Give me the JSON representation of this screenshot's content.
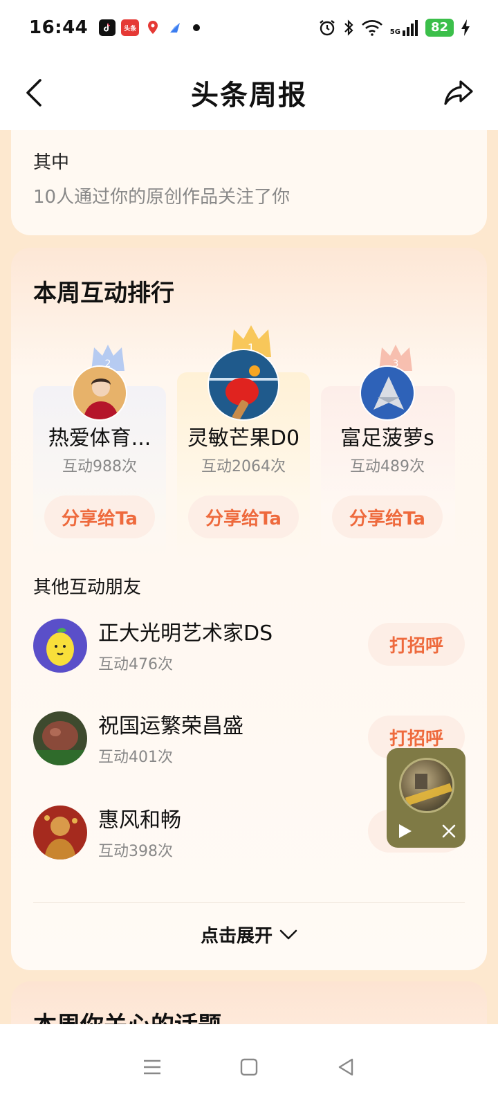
{
  "status_bar": {
    "time": "16:44",
    "battery": "82",
    "network": "5G",
    "toutiao_badge": "头条"
  },
  "header": {
    "title": "头条周报"
  },
  "followers_card": {
    "label": "其中",
    "description": "10人通过你的原创作品关注了你"
  },
  "ranking": {
    "title": "本周互动排行",
    "top": [
      {
        "rank": "2",
        "name": "热爱体育...",
        "count": "互动988次",
        "button": "分享给Ta",
        "crown_color": "#a9c3f2"
      },
      {
        "rank": "1",
        "name": "灵敏芒果D0",
        "count": "互动2064次",
        "button": "分享给Ta",
        "crown_color": "#f7c24a"
      },
      {
        "rank": "3",
        "name": "富足菠萝s",
        "count": "互动489次",
        "button": "分享给Ta",
        "crown_color": "#f6b9a8"
      }
    ],
    "others_title": "其他互动朋友",
    "others": [
      {
        "name": "正大光明艺术家DS",
        "count": "互动476次",
        "button": "打招呼"
      },
      {
        "name": "祝国运繁荣昌盛",
        "count": "互动401次",
        "button": "打招呼"
      },
      {
        "name": "惠风和畅",
        "count": "互动398次",
        "button": "打招呼"
      }
    ],
    "expand_label": "点击展开"
  },
  "topics": {
    "title": "本周你关心的话题"
  },
  "colors": {
    "accent": "#ee6a3d",
    "button_bg": "#fdeee6",
    "page_bg": "#fde8cf"
  }
}
